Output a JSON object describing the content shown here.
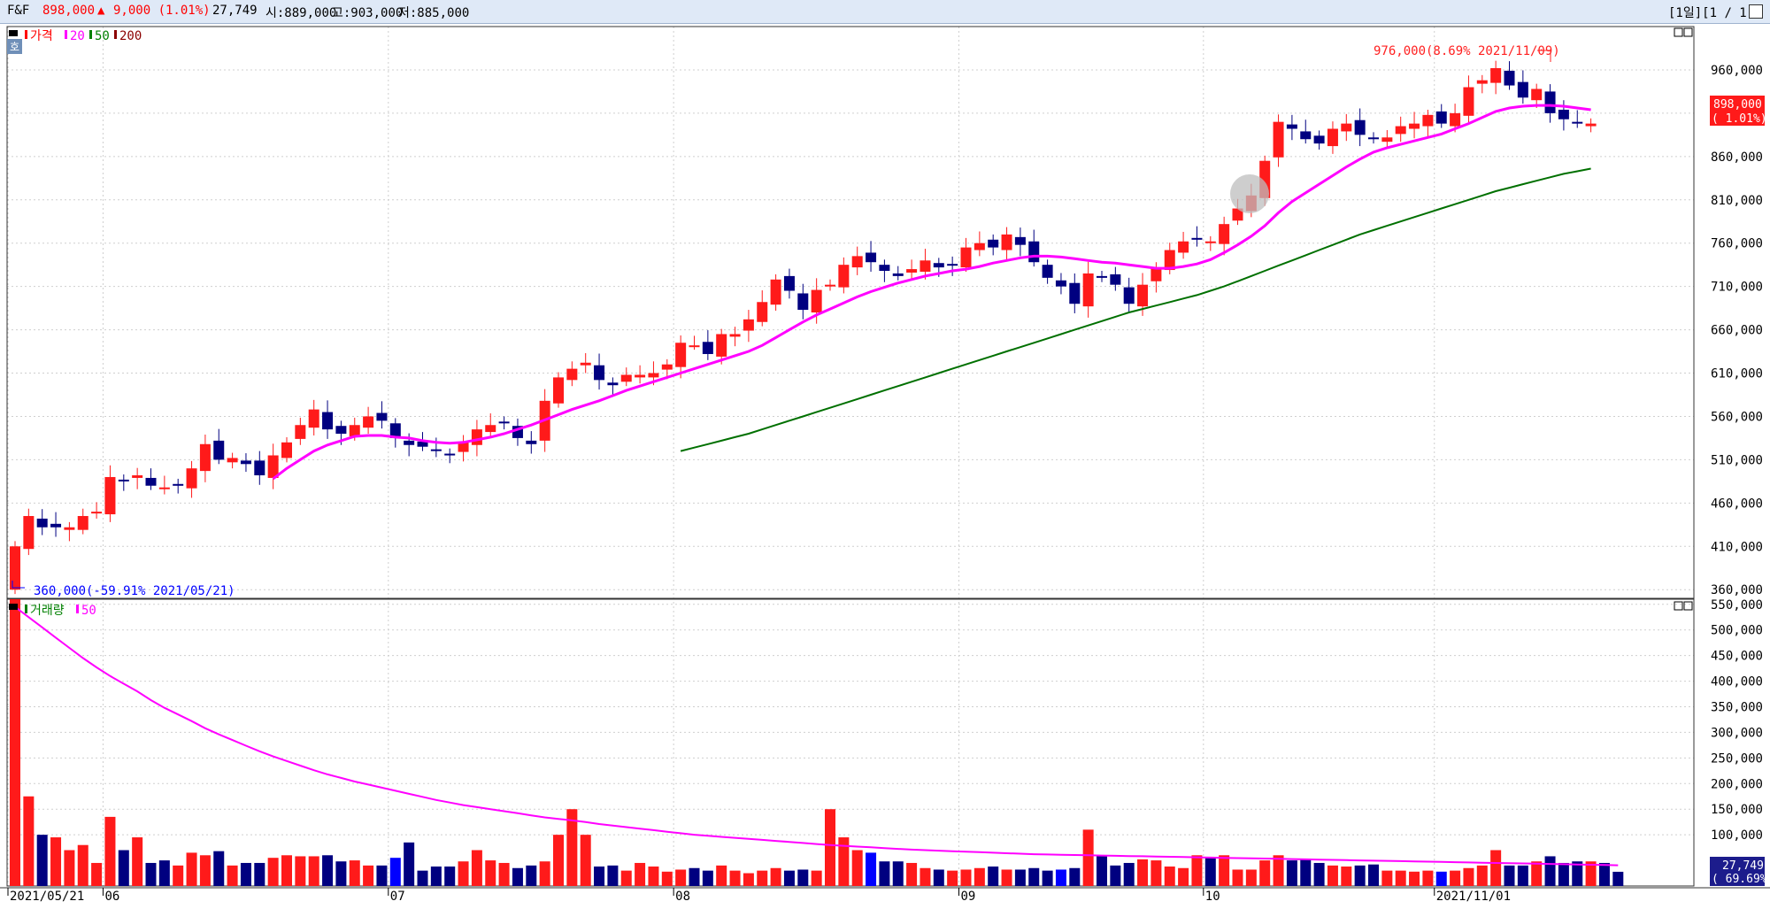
{
  "header": {
    "code": "F&F",
    "price": "898,000",
    "change_arrow": "▲",
    "change": "9,000 (1.01%)",
    "volume": "27,749",
    "open": "시:889,000",
    "high": "고:903,000",
    "low": "저:885,000",
    "period_label": "[1일][1 / 1]"
  },
  "price_panel": {
    "home_icon_label": "호",
    "legend": [
      {
        "name": "가격",
        "color": "#ff0000"
      },
      {
        "name": "20",
        "color": "#ff00ff"
      },
      {
        "name": "50",
        "color": "#008000"
      },
      {
        "name": "200",
        "color": "#8b0000"
      }
    ],
    "max_annotation": "976,000(8.69% 2021/11/09)",
    "min_annotation": "360,000(-59.91% 2021/05/21)",
    "current_price_box": "898,000",
    "current_change_box": "( 1.01%)"
  },
  "volume_panel": {
    "legend": [
      {
        "name": "거래량",
        "color": "#008000"
      },
      {
        "name": "50",
        "color": "#ff00ff"
      }
    ],
    "current_volume_box": "27,749",
    "current_ratio_box": "( 69.69%)"
  },
  "colors": {
    "up": "#ff1a1a",
    "down": "#000080",
    "down_bright": "#0000ff",
    "ma20": "#ff00ff",
    "ma50": "#007000",
    "grid": "#c8c8c8"
  },
  "chart_data": [
    {
      "type": "candlestick",
      "title": "가격",
      "y_ticks": [
        "360,000",
        "410,000",
        "460,000",
        "510,000",
        "560,000",
        "610,000",
        "660,000",
        "710,000",
        "760,000",
        "810,000",
        "860,000",
        "910,000",
        "960,000"
      ],
      "y_tick_values": [
        360000,
        410000,
        460000,
        510000,
        560000,
        610000,
        660000,
        710000,
        760000,
        810000,
        860000,
        910000,
        960000
      ],
      "ylim": [
        350000,
        1010000
      ],
      "x_tick_labels": [
        "2021/05/21",
        "06",
        "07",
        "08",
        "09",
        "10",
        "2021/11/01"
      ],
      "x_tick_index": [
        0,
        7,
        28,
        49,
        70,
        88,
        105
      ],
      "close": [
        410000,
        445000,
        432000,
        432000,
        432000,
        445000,
        450000,
        490000,
        485000,
        492000,
        480000,
        478000,
        480000,
        500000,
        528000,
        510000,
        512000,
        505000,
        492000,
        515000,
        530000,
        550000,
        568000,
        545000,
        540000,
        550000,
        560000,
        555000,
        535000,
        527000,
        525000,
        520000,
        515000,
        530000,
        545000,
        550000,
        552000,
        535000,
        528000,
        578000,
        605000,
        615000,
        622000,
        602000,
        596000,
        608000,
        608000,
        610000,
        620000,
        645000,
        642000,
        632000,
        655000,
        655000,
        672000,
        692000,
        718000,
        705000,
        683000,
        706000,
        712000,
        735000,
        745000,
        738000,
        728000,
        722000,
        730000,
        740000,
        732000,
        735000,
        755000,
        760000,
        755000,
        770000,
        758000,
        738000,
        720000,
        710000,
        690000,
        725000,
        720000,
        712000,
        690000,
        712000,
        732000,
        752000,
        762000,
        765000,
        762000,
        782000,
        800000,
        815000,
        855000,
        900000,
        892000,
        880000,
        875000,
        892000,
        898000,
        885000,
        880000,
        882000,
        895000,
        898000,
        908000,
        898000,
        910000,
        940000,
        948000,
        962000,
        942000,
        928000,
        938000,
        910000,
        903000,
        898000,
        898000
      ],
      "ma20": [
        null,
        null,
        null,
        null,
        null,
        null,
        null,
        null,
        null,
        null,
        null,
        null,
        null,
        null,
        null,
        null,
        null,
        null,
        null,
        488000,
        500000,
        510000,
        520000,
        527000,
        532000,
        537000,
        538000,
        538000,
        536000,
        535000,
        532000,
        530000,
        529000,
        530000,
        533000,
        536000,
        540000,
        545000,
        550000,
        556000,
        562000,
        568000,
        573000,
        578000,
        584000,
        590000,
        595000,
        600000,
        605000,
        610000,
        615000,
        620000,
        625000,
        630000,
        635000,
        642000,
        651000,
        660000,
        669000,
        677000,
        684000,
        691000,
        698000,
        704000,
        709000,
        714000,
        718000,
        722000,
        725000,
        728000,
        730000,
        733000,
        737000,
        740000,
        743000,
        745000,
        745000,
        744000,
        742000,
        740000,
        738000,
        737000,
        735000,
        733000,
        731000,
        731000,
        733000,
        736000,
        741000,
        749000,
        758000,
        768000,
        780000,
        795000,
        808000,
        818000,
        828000,
        838000,
        848000,
        857000,
        865000,
        870000,
        874000,
        878000,
        882000,
        886000,
        892000,
        898000,
        905000,
        912000,
        916000,
        918000,
        919000,
        919000,
        918000,
        916000,
        914000
      ],
      "ma50": [
        null,
        null,
        null,
        null,
        null,
        null,
        null,
        null,
        null,
        null,
        null,
        null,
        null,
        null,
        null,
        null,
        null,
        null,
        null,
        null,
        null,
        null,
        null,
        null,
        null,
        null,
        null,
        null,
        null,
        null,
        null,
        null,
        null,
        null,
        null,
        null,
        null,
        null,
        null,
        null,
        null,
        null,
        null,
        null,
        null,
        null,
        null,
        null,
        null,
        520000,
        524000,
        528000,
        532000,
        536000,
        540000,
        545000,
        550000,
        555000,
        560000,
        565000,
        570000,
        575000,
        580000,
        585000,
        590000,
        595000,
        600000,
        605000,
        610000,
        615000,
        620000,
        625000,
        630000,
        635000,
        640000,
        645000,
        650000,
        655000,
        660000,
        665000,
        670000,
        675000,
        680000,
        684000,
        688000,
        692000,
        696000,
        700000,
        705000,
        710000,
        716000,
        722000,
        728000,
        734000,
        740000,
        746000,
        752000,
        758000,
        764000,
        770000,
        775000,
        780000,
        785000,
        790000,
        795000,
        800000,
        805000,
        810000,
        815000,
        820000,
        824000,
        828000,
        832000,
        836000,
        840000,
        843000,
        846000
      ]
    },
    {
      "type": "bar",
      "title": "거래량",
      "y_ticks": [
        "100,000",
        "150,000",
        "200,000",
        "250,000",
        "300,000",
        "350,000",
        "400,000",
        "450,000",
        "500,000",
        "550,000"
      ],
      "y_tick_values": [
        100000,
        150000,
        200000,
        250000,
        300000,
        350000,
        400000,
        450000,
        500000,
        550000
      ],
      "ylim": [
        0,
        560000
      ],
      "values": [
        560000,
        175000,
        100000,
        95000,
        70000,
        80000,
        45000,
        135000,
        70000,
        95000,
        45000,
        50000,
        40000,
        65000,
        60000,
        68000,
        40000,
        45000,
        45000,
        55000,
        60000,
        58000,
        58000,
        60000,
        48000,
        50000,
        40000,
        40000,
        55000,
        85000,
        30000,
        38000,
        38000,
        48000,
        70000,
        50000,
        45000,
        35000,
        40000,
        48000,
        100000,
        150000,
        100000,
        38000,
        40000,
        30000,
        45000,
        38000,
        28000,
        32000,
        35000,
        30000,
        40000,
        30000,
        25000,
        30000,
        35000,
        30000,
        32000,
        30000,
        150000,
        95000,
        70000,
        65000,
        48000,
        48000,
        45000,
        35000,
        32000,
        30000,
        32000,
        35000,
        38000,
        32000,
        32000,
        35000,
        30000,
        32000,
        35000,
        110000,
        60000,
        40000,
        45000,
        52000,
        50000,
        38000,
        35000,
        60000,
        55000,
        60000,
        32000,
        32000,
        50000,
        60000,
        50000,
        52000,
        45000,
        40000,
        38000,
        40000,
        42000,
        30000,
        30000,
        28000,
        30000,
        28000,
        30000,
        35000,
        40000,
        70000,
        40000,
        40000,
        48000,
        58000,
        45000,
        48000,
        48000,
        45000,
        27749
      ],
      "ma50": [
        545000,
        525000,
        505000,
        485000,
        465000,
        445000,
        427000,
        410000,
        395000,
        380000,
        363000,
        348000,
        335000,
        322000,
        308000,
        296000,
        285000,
        274000,
        263000,
        253000,
        244000,
        235000,
        226000,
        218000,
        211000,
        204000,
        198000,
        192000,
        186000,
        180000,
        174000,
        168000,
        163000,
        158000,
        154000,
        150000,
        146000,
        142000,
        138000,
        134000,
        131000,
        128000,
        125000,
        121000,
        118000,
        115000,
        112000,
        109000,
        106000,
        103000,
        100000,
        98000,
        96000,
        94000,
        92000,
        90000,
        88000,
        86000,
        84000,
        82000,
        80000,
        78500,
        77000,
        75500,
        74000,
        72500,
        71000,
        70000,
        69000,
        68000,
        67000,
        66000,
        65000,
        64000,
        63000,
        62000,
        61500,
        61000,
        60500,
        60000,
        59500,
        59000,
        58500,
        58000,
        57500,
        57000,
        56500,
        56000,
        55500,
        55000,
        54500,
        54000,
        53500,
        53000,
        52500,
        52000,
        51500,
        51000,
        50500,
        50000,
        49500,
        49000,
        48500,
        48000,
        47500,
        47000,
        46500,
        46000,
        45500,
        45000,
        44500,
        44000,
        43500,
        43000,
        42500,
        42000,
        41500,
        41000,
        40500
      ]
    }
  ]
}
